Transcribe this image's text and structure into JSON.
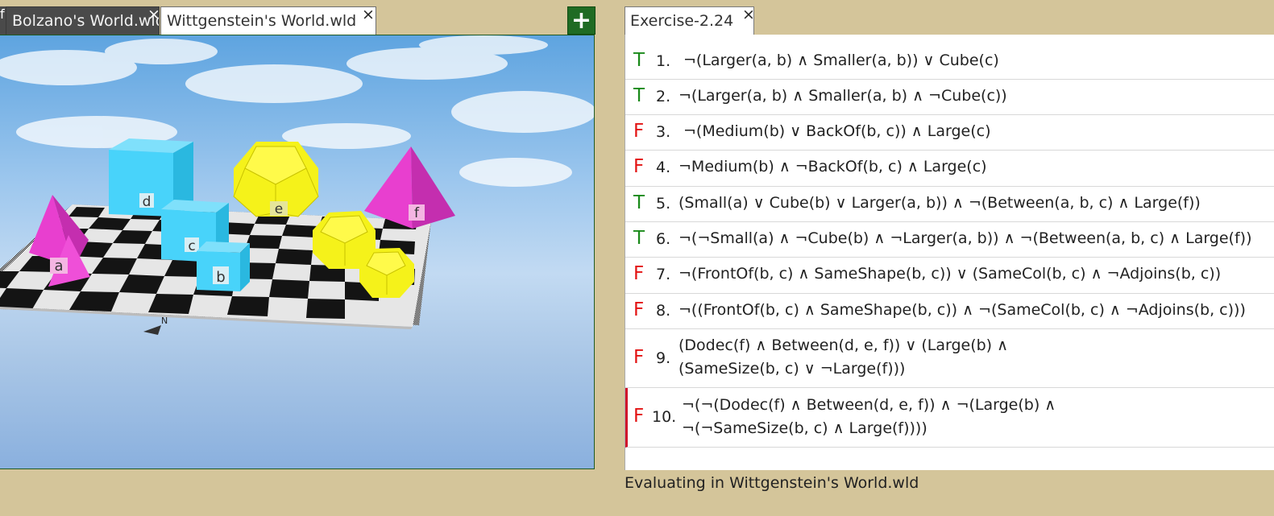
{
  "world_tabs": [
    {
      "label": "Bolzano's World.wld",
      "close": "×"
    },
    {
      "label": "Wittgenstein's World.wld",
      "close": "×"
    }
  ],
  "add_button": "+",
  "world_labels": {
    "a": "a",
    "b": "b",
    "c": "c",
    "d": "d",
    "e": "e",
    "f": "f"
  },
  "exercise_tab": {
    "label": "Exercise-2.24",
    "close": "×"
  },
  "sentences": [
    {
      "value": "T",
      "num": "1.",
      "text": " ¬(Larger(a, b) ∧ Smaller(a, b)) ∨ Cube(c)"
    },
    {
      "value": "T",
      "num": "2.",
      "text": "¬(Larger(a, b) ∧ Smaller(a, b) ∧ ¬Cube(c))"
    },
    {
      "value": "F",
      "num": "3.",
      "text": " ¬(Medium(b) ∨ BackOf(b, c)) ∧ Large(c)"
    },
    {
      "value": "F",
      "num": "4.",
      "text": "¬Medium(b) ∧ ¬BackOf(b, c) ∧ Large(c)"
    },
    {
      "value": "T",
      "num": "5.",
      "text": "(Small(a) ∨ Cube(b) ∨ Larger(a, b)) ∧ ¬(Between(a, b, c) ∧ Large(f))"
    },
    {
      "value": "T",
      "num": "6.",
      "text": "¬(¬Small(a) ∧ ¬Cube(b) ∧ ¬Larger(a, b)) ∧ ¬(Between(a, b, c) ∧ Large(f))"
    },
    {
      "value": "F",
      "num": "7.",
      "text": " ¬(FrontOf(b, c) ∧ SameShape(b, c)) ∨ (SameCol(b, c) ∧ ¬Adjoins(b, c))"
    },
    {
      "value": "F",
      "num": "8.",
      "text": "¬((FrontOf(b, c) ∧ SameShape(b, c)) ∧ ¬(SameCol(b, c) ∧ ¬Adjoins(b, c)))"
    },
    {
      "value": "F",
      "num": "9.",
      "line1": "(Dodec(f) ∧ Between(d, e, f)) ∨ (Large(b) ∧",
      "line2": "(SameSize(b, c) ∨ ¬Large(f)))"
    },
    {
      "value": "F",
      "num": "10.",
      "line1": "¬(¬(Dodec(f) ∧ Between(d, e, f)) ∧ ¬(Large(b) ∧",
      "line2": "¬(¬SameSize(b, c) ∧ Large(f))))"
    }
  ],
  "status": "Evaluating in Wittgenstein's World.wld"
}
